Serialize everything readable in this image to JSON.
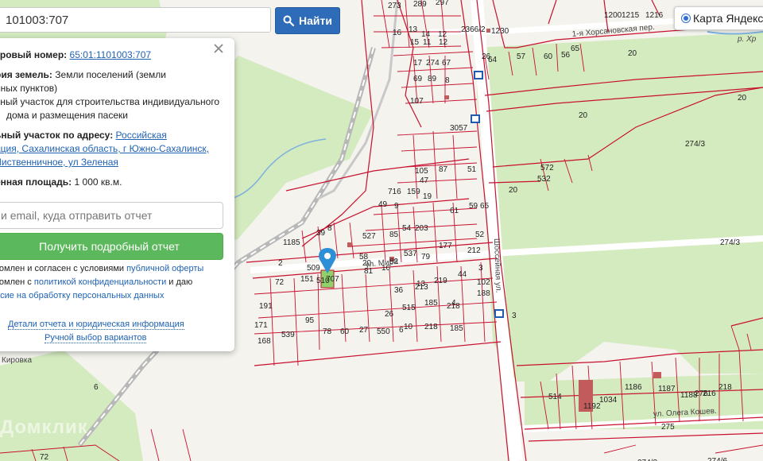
{
  "search": {
    "value": "101003:707",
    "button_label": "Найти"
  },
  "layer_switch": {
    "label": "Карта Яндекс"
  },
  "info_panel": {
    "cadastral_label": "тровый номер:",
    "cadastral_value": "65:01:1101003:707",
    "category_label": "рия земель:",
    "category_value_1": "Земли поселений (земли",
    "category_value_2": "нных пунктов)",
    "usage_1": "ьный участок для строительства индивидуального",
    "usage_2": "дома и размещения пасеки",
    "address_label": "ьный участок по адресу:",
    "address_1": "Российская",
    "address_2": "ация, Сахалинская область, г Южно-Сахалинск,",
    "address_3": "Лиственничное, ул Зеленая",
    "area_label": "енная площадь:",
    "area_value": "1 000 кв.м.",
    "email_placeholder": "и email, куда отправить отчет",
    "report_button": "Получить подробный отчет",
    "terms_1_prefix": "комлен и согласен с условиями",
    "terms_1_link": "публичной оферты",
    "terms_2_prefix": "комлен с",
    "terms_2_link": "политикой конфиденциальности",
    "terms_2_suffix": "и даю",
    "terms_3": "асие на обработку персональных данных",
    "details_link": "Детали отчета и юридическая информация",
    "manual_link": "Ручной выбор вариантов"
  },
  "map": {
    "parcel_labels": [
      "273",
      "289",
      "297",
      "16",
      "13",
      "14",
      "12",
      "15",
      "11",
      "12",
      "2366/2",
      "1230",
      "1200",
      "1215",
      "1216",
      "20",
      "64",
      "57",
      "60",
      "56",
      "65",
      "20",
      "20",
      "17",
      "274",
      "67",
      "69",
      "89",
      "8",
      "107",
      "20",
      "3057",
      "105",
      "87",
      "51",
      "159",
      "47",
      "19",
      "716",
      "49",
      "9",
      "61",
      "59",
      "65",
      "85",
      "54",
      "203",
      "52",
      "572",
      "532",
      "20",
      "274/3",
      "274/3",
      "8",
      "527",
      "58",
      "82",
      "537",
      "79",
      "177",
      "212",
      "39",
      "2",
      "509",
      "151",
      "510",
      "707",
      "81",
      "16",
      "44",
      "3",
      "219",
      "13",
      "102",
      "191",
      "36",
      "213",
      "4",
      "188",
      "515",
      "185",
      "218",
      "171",
      "95",
      "26",
      "6",
      "218",
      "185",
      "168",
      "539",
      "78",
      "60",
      "27",
      "550",
      "10",
      "514",
      "1192",
      "1034",
      "1186",
      "1187",
      "1188",
      "276",
      "216",
      "218",
      "275",
      "1185",
      "26",
      "6",
      "72",
      "72",
      "3",
      "274/2",
      "274/6",
      "20",
      "120"
    ],
    "streets": [
      "ул. Мира",
      "Шоссейная ул.",
      "1-я Хорсановская пер.",
      "ул. Олега Кошев.",
      "р. Хр",
      "Кировка"
    ],
    "watermark": "Домклик"
  },
  "colors": {
    "accent": "#2e6bb8",
    "parcel_line": "#c8102e",
    "selected_parcel": "#8fd16a",
    "forest": "#d6ecc1",
    "green_button": "#5cb85c"
  }
}
